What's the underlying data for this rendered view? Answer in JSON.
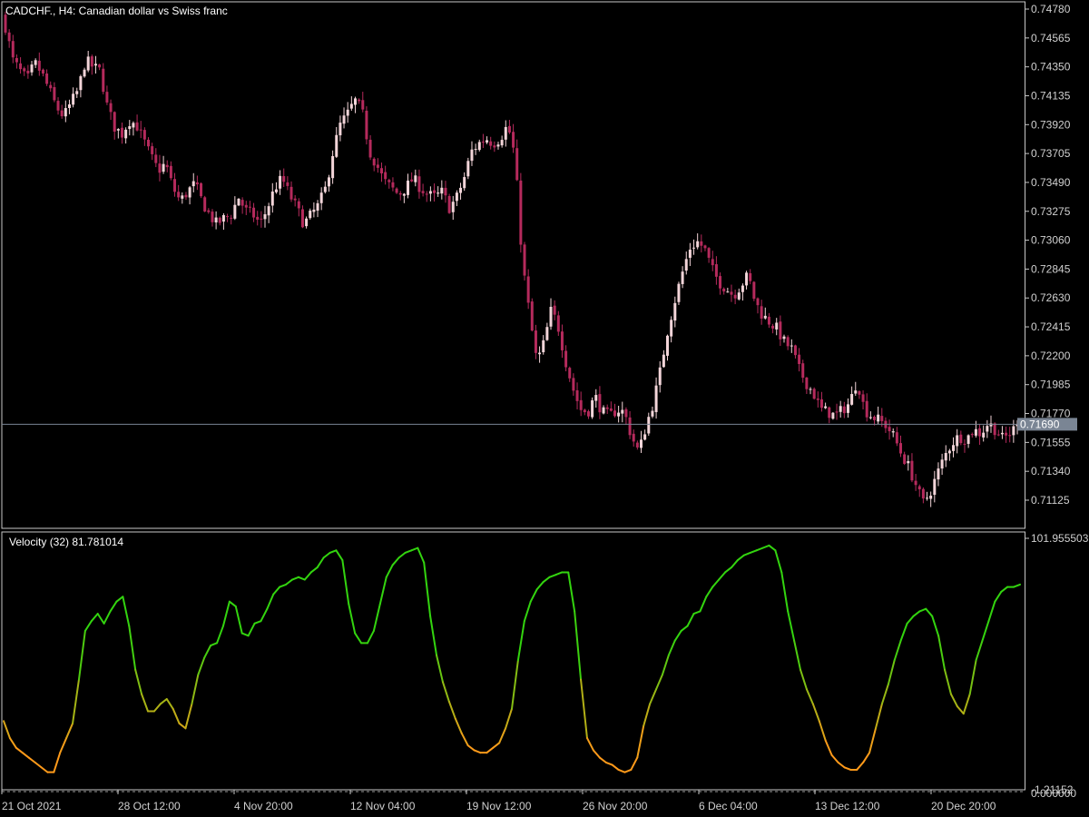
{
  "header": {
    "symbol_text": "CADCHF., H4:  Canadian dollar vs Swiss franc"
  },
  "price_panel": {
    "y_ticks": [
      "0.74780",
      "0.74565",
      "0.74350",
      "0.74135",
      "0.73920",
      "0.73705",
      "0.73490",
      "0.73275",
      "0.73060",
      "0.72845",
      "0.72630",
      "0.72415",
      "0.72200",
      "0.71985",
      "0.71770",
      "0.71555",
      "0.71340",
      "0.71125"
    ],
    "current_price_label": "0.71690",
    "current_price": 0.7169
  },
  "indicator_panel": {
    "label": "Velocity (32) 81.781014",
    "y_max_label": "101.955503",
    "y_min_label": "-1.21152",
    "y_zero_label": "0.000000"
  },
  "x_axis": {
    "labels": [
      "21 Oct 2021",
      "28 Oct 12:00",
      "4 Nov 20:00",
      "12 Nov 04:00",
      "19 Nov 12:00",
      "26 Nov 20:00",
      "6 Dec 04:00",
      "13 Dec 12:00",
      "20 Dec 20:00"
    ]
  },
  "colors": {
    "background": "#000000",
    "candle_up": "#F3D5D9",
    "candle_down": "#B52A5C",
    "grid_frame": "#C8C8C8",
    "bid_line": "#7A8594",
    "price_label_bg": "#7A8594",
    "velocity_high": "#33D40F",
    "velocity_low": "#FF9A1A"
  },
  "chart_data": [
    {
      "type": "candlestick",
      "title": "CADCHF., H4:  Canadian dollar vs Swiss franc",
      "ylim": [
        0.7098,
        0.7483
      ],
      "close_path": [
        [
          0,
          0.7465
        ],
        [
          3,
          0.744
        ],
        [
          6,
          0.7432
        ],
        [
          9,
          0.7425
        ],
        [
          12,
          0.7438
        ],
        [
          15,
          0.743
        ],
        [
          18,
          0.7418
        ],
        [
          21,
          0.7405
        ],
        [
          24,
          0.7398
        ],
        [
          27,
          0.7408
        ],
        [
          30,
          0.7418
        ],
        [
          33,
          0.744
        ],
        [
          36,
          0.7435
        ],
        [
          39,
          0.7432
        ],
        [
          42,
          0.7405
        ],
        [
          45,
          0.739
        ],
        [
          48,
          0.7385
        ],
        [
          51,
          0.7395
        ],
        [
          54,
          0.7392
        ],
        [
          57,
          0.738
        ],
        [
          60,
          0.7368
        ],
        [
          63,
          0.7358
        ],
        [
          66,
          0.7363
        ],
        [
          69,
          0.7345
        ],
        [
          72,
          0.7335
        ],
        [
          75,
          0.7342
        ],
        [
          78,
          0.7348
        ],
        [
          81,
          0.7335
        ],
        [
          84,
          0.7325
        ],
        [
          87,
          0.7318
        ],
        [
          90,
          0.7322
        ],
        [
          93,
          0.7325
        ],
        [
          96,
          0.7338
        ],
        [
          99,
          0.7328
        ],
        [
          102,
          0.7325
        ],
        [
          105,
          0.7318
        ],
        [
          108,
          0.733
        ],
        [
          111,
          0.7345
        ],
        [
          114,
          0.7352
        ],
        [
          117,
          0.734
        ],
        [
          120,
          0.733
        ],
        [
          123,
          0.7318
        ],
        [
          126,
          0.7325
        ],
        [
          129,
          0.7332
        ],
        [
          132,
          0.7345
        ],
        [
          135,
          0.7372
        ],
        [
          138,
          0.7392
        ],
        [
          141,
          0.74
        ],
        [
          144,
          0.741
        ],
        [
          147,
          0.7402
        ],
        [
          150,
          0.7372
        ],
        [
          153,
          0.7362
        ],
        [
          156,
          0.735
        ],
        [
          159,
          0.7345
        ],
        [
          162,
          0.734
        ],
        [
          165,
          0.7345
        ],
        [
          168,
          0.7352
        ],
        [
          171,
          0.7345
        ],
        [
          174,
          0.734
        ],
        [
          177,
          0.7338
        ],
        [
          180,
          0.7342
        ],
        [
          183,
          0.733
        ],
        [
          186,
          0.7338
        ],
        [
          189,
          0.7352
        ],
        [
          192,
          0.7372
        ],
        [
          195,
          0.7378
        ],
        [
          198,
          0.7382
        ],
        [
          201,
          0.7378
        ],
        [
          204,
          0.7382
        ],
        [
          207,
          0.7392
        ],
        [
          210,
          0.7368
        ],
        [
          213,
          0.729
        ],
        [
          216,
          0.725
        ],
        [
          219,
          0.7215
        ],
        [
          222,
          0.723
        ],
        [
          225,
          0.7255
        ],
        [
          228,
          0.724
        ],
        [
          231,
          0.7215
        ],
        [
          234,
          0.7195
        ],
        [
          237,
          0.718
        ],
        [
          240,
          0.7178
        ],
        [
          243,
          0.719
        ],
        [
          246,
          0.7178
        ],
        [
          249,
          0.7175
        ],
        [
          252,
          0.718
        ],
        [
          255,
          0.7178
        ],
        [
          258,
          0.716
        ],
        [
          261,
          0.7148
        ],
        [
          264,
          0.7168
        ],
        [
          267,
          0.7185
        ],
        [
          270,
          0.721
        ],
        [
          273,
          0.724
        ],
        [
          276,
          0.7262
        ],
        [
          279,
          0.7282
        ],
        [
          282,
          0.73
        ],
        [
          285,
          0.7305
        ],
        [
          288,
          0.73
        ],
        [
          291,
          0.7285
        ],
        [
          294,
          0.7275
        ],
        [
          297,
          0.727
        ],
        [
          300,
          0.7265
        ],
        [
          303,
          0.7272
        ],
        [
          306,
          0.728
        ],
        [
          309,
          0.726
        ],
        [
          312,
          0.725
        ],
        [
          315,
          0.7245
        ],
        [
          318,
          0.724
        ],
        [
          321,
          0.723
        ],
        [
          324,
          0.7225
        ],
        [
          327,
          0.721
        ],
        [
          330,
          0.72
        ],
        [
          333,
          0.7192
        ],
        [
          336,
          0.718
        ],
        [
          339,
          0.7178
        ],
        [
          342,
          0.7175
        ],
        [
          345,
          0.718
        ],
        [
          348,
          0.7185
        ],
        [
          351,
          0.7202
        ],
        [
          354,
          0.718
        ],
        [
          357,
          0.7175
        ],
        [
          360,
          0.7172
        ],
        [
          363,
          0.7168
        ],
        [
          366,
          0.716
        ],
        [
          369,
          0.7148
        ],
        [
          372,
          0.7138
        ],
        [
          375,
          0.7125
        ],
        [
          378,
          0.711
        ],
        [
          381,
          0.7118
        ],
        [
          384,
          0.7132
        ],
        [
          387,
          0.7145
        ],
        [
          390,
          0.7155
        ],
        [
          393,
          0.716
        ],
        [
          396,
          0.7158
        ],
        [
          399,
          0.7165
        ],
        [
          402,
          0.7162
        ],
        [
          405,
          0.717
        ],
        [
          408,
          0.7165
        ],
        [
          411,
          0.7158
        ],
        [
          414,
          0.7162
        ],
        [
          417,
          0.7169
        ]
      ]
    },
    {
      "type": "line",
      "title": "Velocity (32) 81.781014",
      "ylim": [
        -1.21152,
        101.955503
      ],
      "points": [
        [
          0,
          27
        ],
        [
          3,
          20
        ],
        [
          6,
          16
        ],
        [
          9,
          14
        ],
        [
          12,
          12
        ],
        [
          15,
          10
        ],
        [
          18,
          8
        ],
        [
          21,
          6
        ],
        [
          24,
          6
        ],
        [
          27,
          14
        ],
        [
          30,
          20
        ],
        [
          33,
          26
        ],
        [
          36,
          44
        ],
        [
          39,
          64
        ],
        [
          42,
          68
        ],
        [
          45,
          71
        ],
        [
          48,
          67
        ],
        [
          51,
          72
        ],
        [
          54,
          76
        ],
        [
          57,
          78
        ],
        [
          60,
          66
        ],
        [
          63,
          48
        ],
        [
          66,
          38
        ],
        [
          69,
          31
        ],
        [
          72,
          31
        ],
        [
          75,
          34
        ],
        [
          78,
          36
        ],
        [
          81,
          32
        ],
        [
          84,
          26
        ],
        [
          87,
          24
        ],
        [
          90,
          34
        ],
        [
          93,
          46
        ],
        [
          96,
          53
        ],
        [
          99,
          58
        ],
        [
          102,
          59
        ],
        [
          105,
          66
        ],
        [
          108,
          76
        ],
        [
          111,
          74
        ],
        [
          114,
          63
        ],
        [
          117,
          62
        ],
        [
          120,
          67
        ],
        [
          123,
          68
        ],
        [
          126,
          73
        ],
        [
          129,
          79
        ],
        [
          132,
          82
        ],
        [
          135,
          83
        ],
        [
          138,
          85
        ],
        [
          141,
          86
        ],
        [
          144,
          85
        ],
        [
          147,
          88
        ],
        [
          150,
          90
        ],
        [
          153,
          94
        ],
        [
          156,
          96
        ],
        [
          159,
          97
        ],
        [
          162,
          93
        ],
        [
          165,
          75
        ],
        [
          168,
          63
        ],
        [
          171,
          59
        ],
        [
          174,
          59
        ],
        [
          177,
          64
        ],
        [
          180,
          75
        ],
        [
          183,
          86
        ],
        [
          186,
          91
        ],
        [
          189,
          94
        ],
        [
          192,
          96
        ],
        [
          195,
          97
        ],
        [
          198,
          98
        ],
        [
          201,
          92
        ],
        [
          204,
          70
        ],
        [
          207,
          54
        ],
        [
          210,
          43
        ],
        [
          213,
          35
        ],
        [
          216,
          28
        ],
        [
          219,
          22
        ],
        [
          222,
          17
        ],
        [
          225,
          15
        ],
        [
          228,
          14
        ],
        [
          231,
          14
        ],
        [
          234,
          16
        ],
        [
          237,
          18
        ],
        [
          240,
          24
        ],
        [
          243,
          32
        ],
        [
          246,
          52
        ],
        [
          249,
          68
        ],
        [
          252,
          76
        ],
        [
          255,
          81
        ],
        [
          258,
          84
        ],
        [
          261,
          86
        ],
        [
          264,
          87
        ],
        [
          267,
          88
        ],
        [
          270,
          88
        ],
        [
          273,
          72
        ],
        [
          276,
          44
        ],
        [
          279,
          20
        ],
        [
          282,
          15
        ],
        [
          285,
          12
        ],
        [
          288,
          10
        ],
        [
          291,
          9
        ],
        [
          294,
          7
        ],
        [
          297,
          6
        ],
        [
          300,
          7
        ],
        [
          303,
          12
        ],
        [
          306,
          25
        ],
        [
          309,
          34
        ],
        [
          312,
          40
        ],
        [
          315,
          46
        ],
        [
          318,
          54
        ],
        [
          321,
          60
        ],
        [
          324,
          64
        ],
        [
          327,
          66
        ],
        [
          330,
          71
        ],
        [
          333,
          72
        ],
        [
          336,
          78
        ],
        [
          339,
          82
        ],
        [
          342,
          85
        ],
        [
          345,
          88
        ],
        [
          348,
          90
        ],
        [
          351,
          93
        ],
        [
          354,
          95
        ],
        [
          357,
          96
        ],
        [
          360,
          97
        ],
        [
          363,
          98
        ],
        [
          366,
          99
        ],
        [
          369,
          97
        ],
        [
          372,
          88
        ],
        [
          375,
          72
        ],
        [
          378,
          60
        ],
        [
          381,
          48
        ],
        [
          384,
          40
        ],
        [
          387,
          34
        ],
        [
          390,
          27
        ],
        [
          393,
          19
        ],
        [
          396,
          13
        ],
        [
          399,
          10
        ],
        [
          402,
          8
        ],
        [
          405,
          7
        ],
        [
          408,
          7
        ],
        [
          411,
          10
        ],
        [
          414,
          14
        ],
        [
          417,
          24
        ],
        [
          420,
          34
        ],
        [
          423,
          42
        ],
        [
          426,
          52
        ],
        [
          429,
          60
        ],
        [
          432,
          67
        ],
        [
          435,
          70
        ],
        [
          438,
          72
        ],
        [
          441,
          73
        ],
        [
          444,
          70
        ],
        [
          447,
          62
        ],
        [
          450,
          48
        ],
        [
          453,
          38
        ],
        [
          456,
          33
        ],
        [
          459,
          30
        ],
        [
          462,
          38
        ],
        [
          465,
          52
        ],
        [
          468,
          60
        ],
        [
          471,
          68
        ],
        [
          474,
          76
        ],
        [
          477,
          80
        ],
        [
          480,
          82
        ],
        [
          483,
          82
        ],
        [
          486,
          83
        ]
      ]
    }
  ]
}
